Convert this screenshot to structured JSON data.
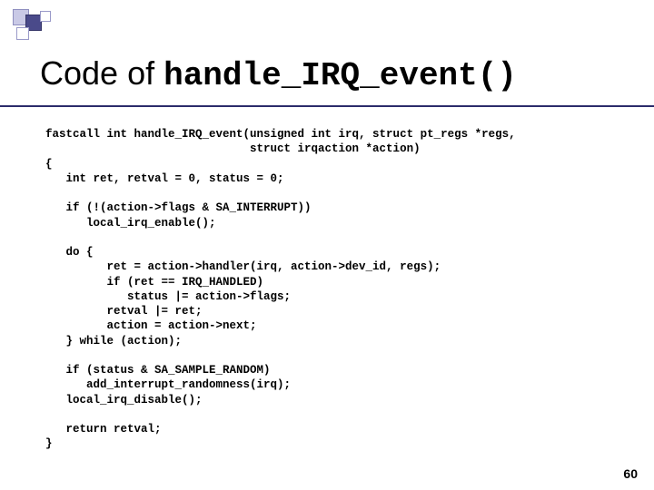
{
  "slide": {
    "title_prefix": "Code of ",
    "title_code": "handle_IRQ_event()",
    "page_number": "60"
  },
  "code": {
    "line01": "fastcall int handle_IRQ_event(unsigned int irq, struct pt_regs *regs,",
    "line02": "                              struct irqaction *action)",
    "line03": "{",
    "line04": "   int ret, retval = 0, status = 0;",
    "line05": "",
    "line06": "   if (!(action->flags & SA_INTERRUPT))",
    "line07": "      local_irq_enable();",
    "line08": "",
    "line09": "   do {",
    "line10": "         ret = action->handler(irq, action->dev_id, regs);",
    "line11": "         if (ret == IRQ_HANDLED)",
    "line12": "            status |= action->flags;",
    "line13": "         retval |= ret;",
    "line14": "         action = action->next;",
    "line15": "   } while (action);",
    "line16": "",
    "line17": "   if (status & SA_SAMPLE_RANDOM)",
    "line18": "      add_interrupt_randomness(irq);",
    "line19": "   local_irq_disable();",
    "line20": "",
    "line21": "   return retval;",
    "line22": "}"
  }
}
